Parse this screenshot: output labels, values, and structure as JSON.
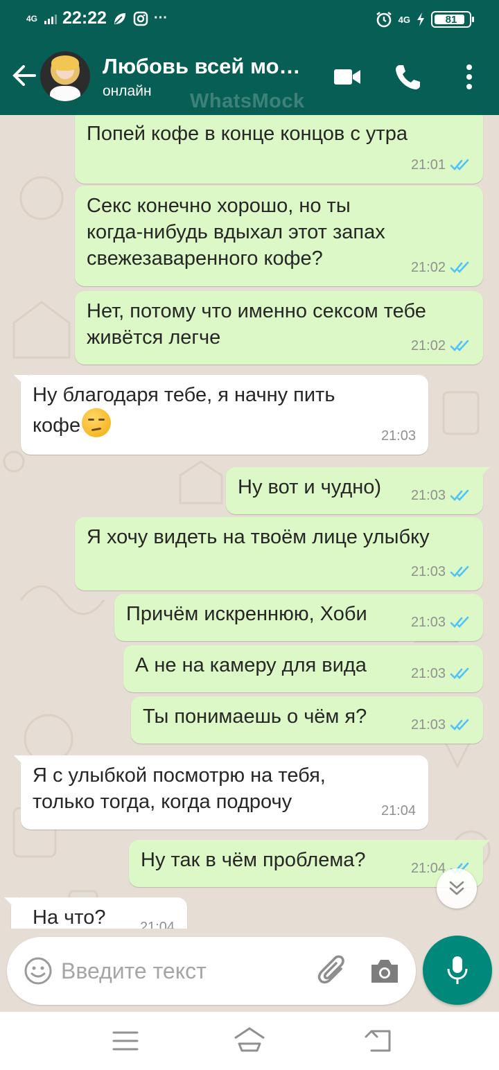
{
  "status_bar": {
    "network": "4G",
    "time": "22:22",
    "more": "···",
    "network_right": "4G",
    "battery": "81"
  },
  "header": {
    "contact_name": "Любовь всей мо…",
    "status": "онлайн",
    "watermark": "WhatsMock"
  },
  "messages": [
    {
      "dir": "out",
      "text": "Попей кофе в конце концов с утра",
      "time": "21:01",
      "read": true
    },
    {
      "dir": "out",
      "text": "Секс конечно хорошо, но ты\nкогда-нибудь вдыхал этот запах\nсвежезаваренного кофе?",
      "time": "21:02",
      "read": true
    },
    {
      "dir": "out",
      "text": "Нет, потому что именно сексом тебе\nживётся легче",
      "time": "21:02",
      "read": true
    },
    {
      "dir": "in",
      "text": "Ну благодаря тебе, я начну пить\nкофе",
      "emoji": "unamused-face",
      "time": "21:03"
    },
    {
      "dir": "out",
      "text": "Ну вот и чудно)",
      "time": "21:03",
      "read": true
    },
    {
      "dir": "out",
      "text": "Я хочу видеть на твоём лице улыбку",
      "time": "21:03",
      "read": true
    },
    {
      "dir": "out",
      "text": "Причём искреннюю, Хоби",
      "time": "21:03",
      "read": true
    },
    {
      "dir": "out",
      "text": "А не на камеру для вида",
      "time": "21:03",
      "read": true
    },
    {
      "dir": "out",
      "text": "Ты понимаешь о чём я?",
      "time": "21:03",
      "read": true
    },
    {
      "dir": "in",
      "text": "Я с улыбкой посмотрю на тебя,\nтолько тогда, когда подрочу",
      "time": "21:04"
    },
    {
      "dir": "out",
      "text": "Ну так в чём проблема?",
      "time": "21:04",
      "read": true
    },
    {
      "dir": "in",
      "text": "На что?",
      "time": "21:04"
    }
  ],
  "input": {
    "placeholder": "Введите текст",
    "value": ""
  },
  "colors": {
    "header": "#075e54",
    "outgoing_bubble": "#dcf8c6",
    "incoming_bubble": "#ffffff",
    "chat_background": "#e6ddd4",
    "read_ticks": "#4fc3f7",
    "mic_button": "#00897b"
  },
  "icons": {
    "back": "arrow-left-icon",
    "video": "video-camera-icon",
    "call": "phone-icon",
    "menu": "more-vertical-icon",
    "emoji": "smiley-icon",
    "attach": "paperclip-icon",
    "camera": "camera-icon",
    "mic": "microphone-icon",
    "scroll": "chevron-double-down-icon"
  }
}
